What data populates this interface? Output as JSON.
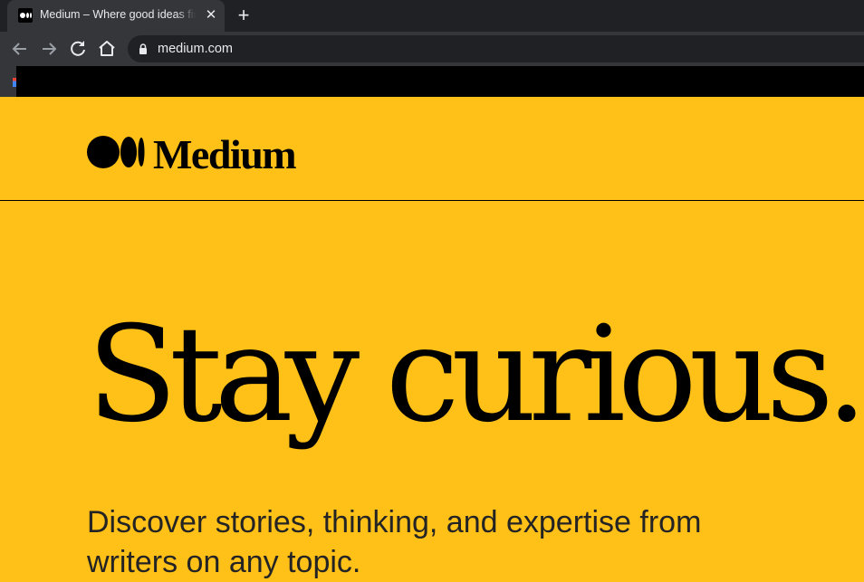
{
  "browser": {
    "tab_title": "Medium – Where good ideas find you.",
    "url": "medium.com",
    "icons": [
      "medium-favicon",
      "close-icon",
      "plus-icon",
      "back-arrow-icon",
      "forward-arrow-icon",
      "reload-icon",
      "home-icon",
      "lock-icon"
    ]
  },
  "header": {
    "logo_text": "Medium"
  },
  "hero": {
    "title": "Stay curious.",
    "subtitle": "Discover stories, thinking, and expertise from writers on any topic."
  },
  "colors": {
    "background": "#ffc017",
    "text": "#000000",
    "chrome_dark": "#202124",
    "chrome": "#35363a"
  }
}
